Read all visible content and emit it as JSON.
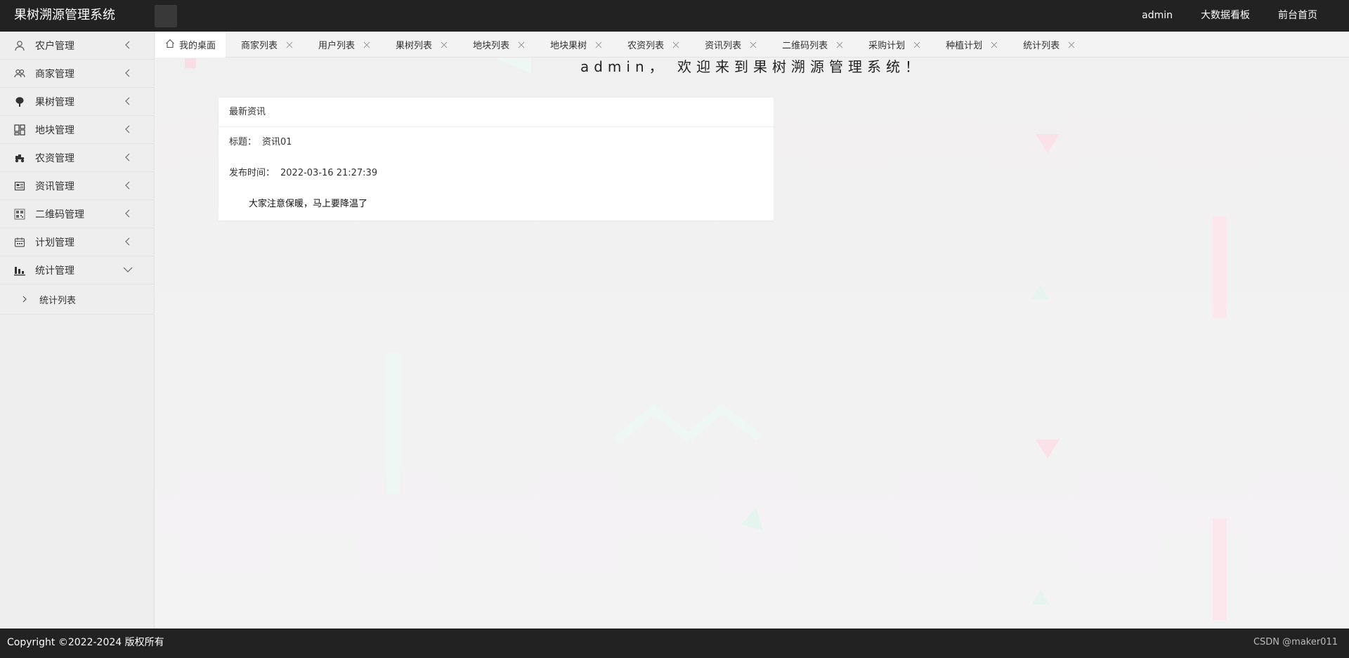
{
  "header": {
    "title": "果树溯源管理系统",
    "nav": [
      "admin",
      "大数据看板",
      "前台首页"
    ]
  },
  "sidebar": {
    "items": [
      {
        "label": "农户管理",
        "icon": "user-icon"
      },
      {
        "label": "商家管理",
        "icon": "users-icon"
      },
      {
        "label": "果树管理",
        "icon": "tree-icon"
      },
      {
        "label": "地块管理",
        "icon": "grid-icon"
      },
      {
        "label": "农资管理",
        "icon": "tractor-icon"
      },
      {
        "label": "资讯管理",
        "icon": "news-icon"
      },
      {
        "label": "二维码管理",
        "icon": "qrcode-icon"
      },
      {
        "label": "计划管理",
        "icon": "plan-icon"
      },
      {
        "label": "统计管理",
        "icon": "chart-icon",
        "expanded": true
      }
    ],
    "submenu": [
      "统计列表"
    ]
  },
  "tabs": {
    "home": "我的桌面",
    "items": [
      "商家列表",
      "用户列表",
      "果树列表",
      "地块列表",
      "地块果树",
      "农资列表",
      "资讯列表",
      "二维码列表",
      "采购计划",
      "种植计划",
      "统计列表"
    ]
  },
  "main": {
    "welcome": "admin， 欢迎来到果树溯源管理系统！",
    "news": {
      "header": "最新资讯",
      "title_label": "标题：",
      "title_value": "资讯01",
      "time_label": "发布时间：",
      "time_value": "2022-03-16 21:27:39",
      "content": "大家注意保暖，马上要降温了"
    }
  },
  "footer": {
    "copyright": "Copyright ©2022-2024 版权所有",
    "watermark": "CSDN @maker011"
  },
  "colors": {
    "header_bg": "#222222",
    "sidebar_bg": "#eeeeee",
    "main_bg": "#f2f1f2"
  }
}
